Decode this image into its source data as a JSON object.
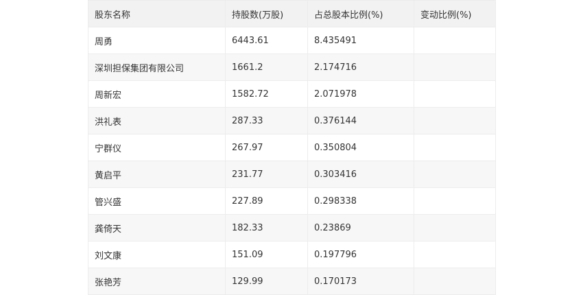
{
  "table": {
    "headers": [
      "股东名称",
      "持股数(万股)",
      "占总股本比例(%)",
      "变动比例(%)"
    ],
    "rows": [
      [
        "周勇",
        "6443.61",
        "8.435491",
        ""
      ],
      [
        "深圳担保集团有限公司",
        "1661.2",
        "2.174716",
        ""
      ],
      [
        "周新宏",
        "1582.72",
        "2.071978",
        ""
      ],
      [
        "洪礼表",
        "287.33",
        "0.376144",
        ""
      ],
      [
        "宁群仪",
        "267.97",
        "0.350804",
        ""
      ],
      [
        "黄启平",
        "231.77",
        "0.303416",
        ""
      ],
      [
        "管兴盛",
        "227.89",
        "0.298338",
        ""
      ],
      [
        "龚倚天",
        "182.33",
        "0.23869",
        ""
      ],
      [
        "刘文康",
        "151.09",
        "0.197796",
        ""
      ],
      [
        "张艳芳",
        "129.99",
        "0.170173",
        ""
      ]
    ]
  }
}
